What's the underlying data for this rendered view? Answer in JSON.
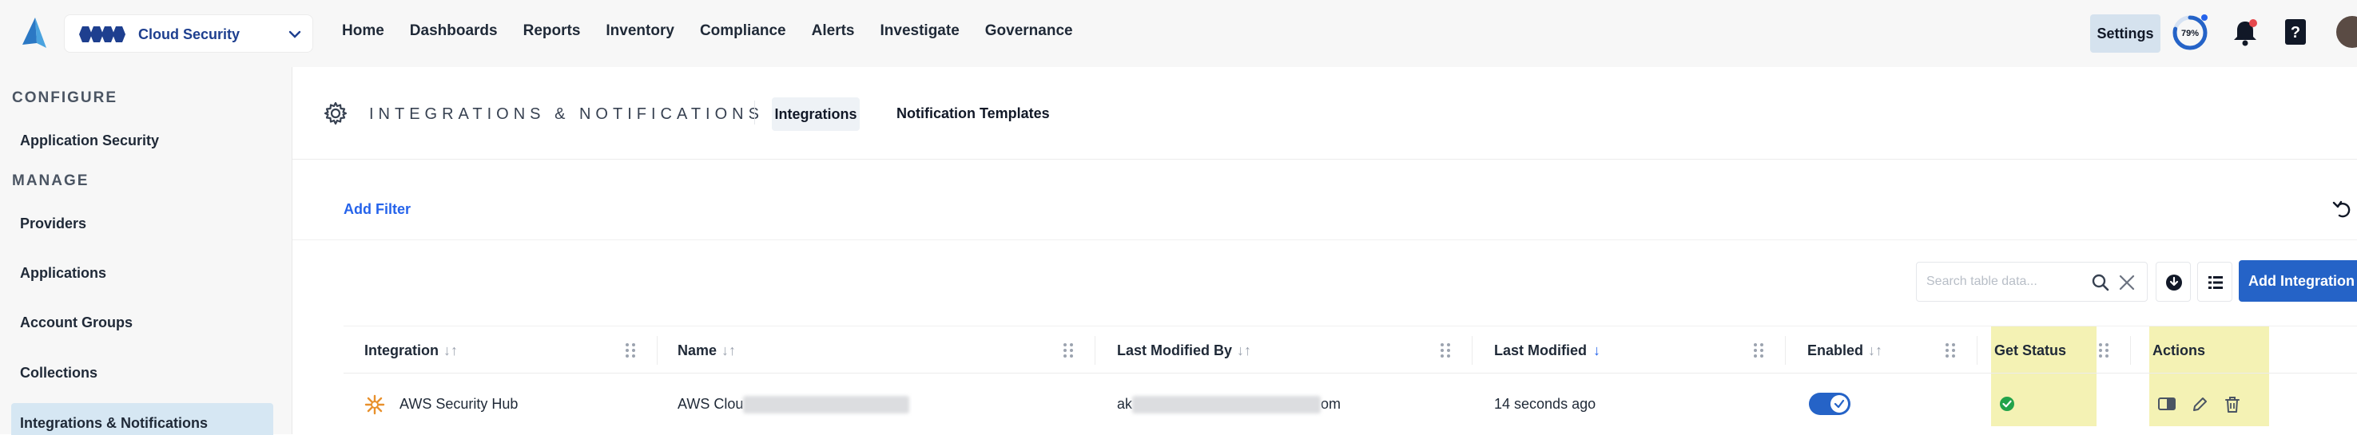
{
  "topnav": {
    "tenant_label": "Cloud Security",
    "links": [
      "Home",
      "Dashboards",
      "Reports",
      "Inventory",
      "Compliance",
      "Alerts",
      "Investigate",
      "Governance"
    ],
    "settings_label": "Settings",
    "progress_text": "79%",
    "progress_value": 0.79
  },
  "sidebar": {
    "configure_heading": "CONFIGURE",
    "configure_items": [
      "Application Security"
    ],
    "manage_heading": "MANAGE",
    "manage_items": [
      "Providers",
      "Applications",
      "Account Groups",
      "Collections",
      "Integrations & Notifications"
    ],
    "active_item": "Integrations & Notifications"
  },
  "page": {
    "title": "INTEGRATIONS & NOTIFICATIONS",
    "tabs": [
      "Integrations",
      "Notification Templates"
    ],
    "active_tab": "Integrations"
  },
  "filter": {
    "add_filter_label": "Add Filter"
  },
  "toolbar": {
    "search_placeholder": "Search table data...",
    "add_integration_label": "Add Integration"
  },
  "table": {
    "columns": [
      "Integration",
      "Name",
      "Last Modified By",
      "Last Modified",
      "Enabled",
      "Get Status",
      "Actions"
    ],
    "sorted_column": "Last Modified",
    "rows": [
      {
        "integration": "AWS Security Hub",
        "name_prefix": "AWS Clou",
        "modified_by_prefix": "ak",
        "modified_by_suffix": "om",
        "last_modified": "14 seconds ago",
        "enabled": true,
        "status": "ok"
      }
    ]
  },
  "colors": {
    "accent": "#2563c7",
    "link": "#2563eb",
    "highlight": "#f4f2b4",
    "sidebar_active": "#d6e7f3",
    "status_ok": "#22a34a"
  }
}
